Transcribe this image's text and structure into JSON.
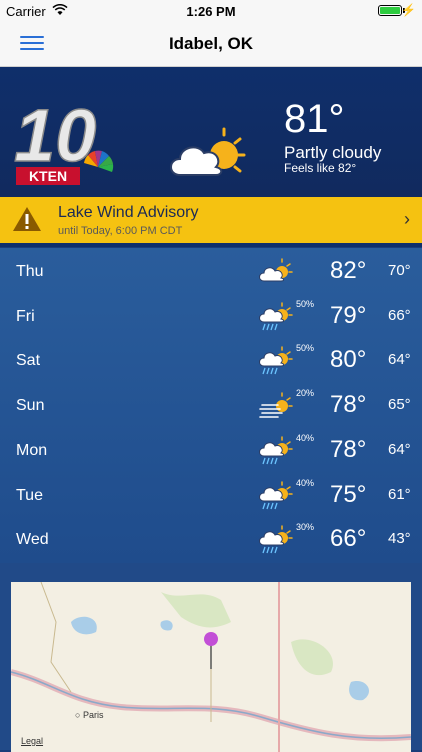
{
  "status": {
    "carrier": "Carrier",
    "time": "1:26 PM",
    "battery_level": 1.0
  },
  "nav": {
    "title": "Idabel, OK"
  },
  "logo": {
    "number": "10",
    "station": "KTEN"
  },
  "current": {
    "temp": "81°",
    "condition": "Partly cloudy",
    "feels_like": "Feels like 82°",
    "icon": "partly-cloudy-icon"
  },
  "advisory": {
    "title": "Lake Wind Advisory",
    "subtitle": "until Today, 6:00 PM CDT"
  },
  "forecast": [
    {
      "day": "Thu",
      "hi": "82°",
      "lo": "70°",
      "pop": "",
      "icon": "partly-cloudy-icon"
    },
    {
      "day": "Fri",
      "hi": "79°",
      "lo": "66°",
      "pop": "50%",
      "icon": "rain-icon"
    },
    {
      "day": "Sat",
      "hi": "80°",
      "lo": "64°",
      "pop": "50%",
      "icon": "rain-icon"
    },
    {
      "day": "Sun",
      "hi": "78°",
      "lo": "65°",
      "pop": "20%",
      "icon": "fog-icon"
    },
    {
      "day": "Mon",
      "hi": "78°",
      "lo": "64°",
      "pop": "40%",
      "icon": "rain-icon"
    },
    {
      "day": "Tue",
      "hi": "75°",
      "lo": "61°",
      "pop": "40%",
      "icon": "rain-icon"
    },
    {
      "day": "Wed",
      "hi": "66°",
      "lo": "43°",
      "pop": "30%",
      "icon": "rain-icon"
    }
  ],
  "map": {
    "city_label": "Paris",
    "legal": "Legal"
  }
}
